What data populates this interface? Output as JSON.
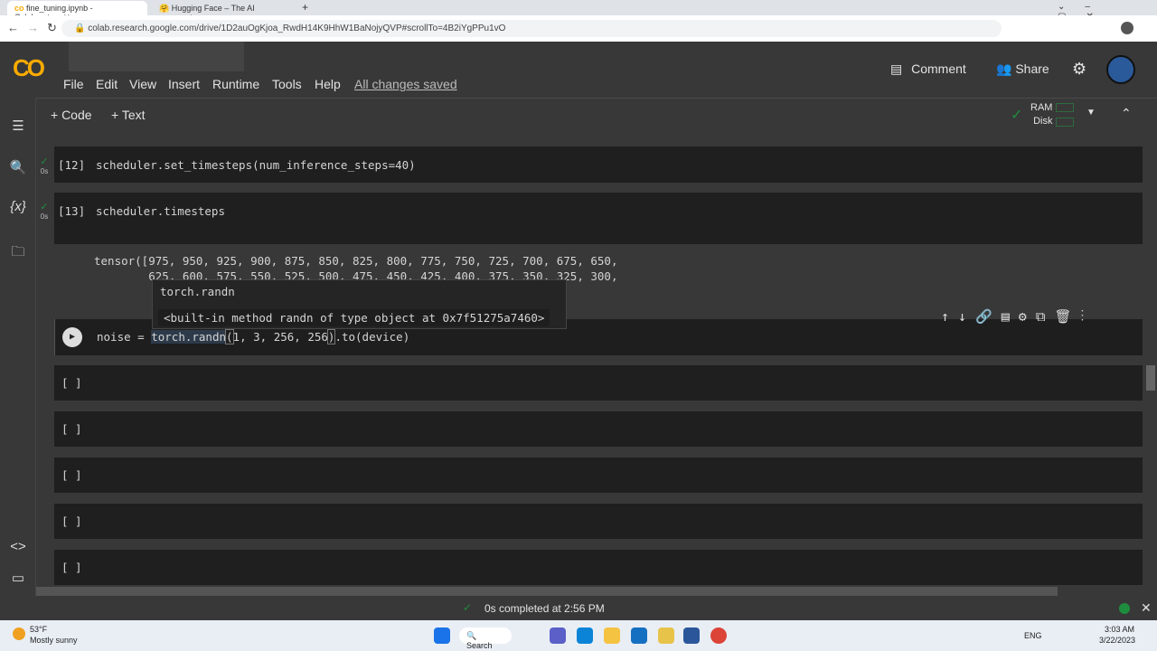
{
  "browser": {
    "tabs": [
      {
        "label": "fine_tuning.ipynb - Colaboratory",
        "active": true
      },
      {
        "label": "Hugging Face – The AI communi",
        "active": false
      }
    ],
    "url": "colab.research.google.com/drive/1D2auOgKjoa_RwdH14K9HhW1BaNojyQVP#scrollTo=4B2iYgPPu1vO"
  },
  "header": {
    "logo": "CO",
    "menu": [
      "File",
      "Edit",
      "View",
      "Insert",
      "Runtime",
      "Tools",
      "Help"
    ],
    "save_status": "All changes saved",
    "comment": "Comment",
    "share": "Share"
  },
  "toolbar": {
    "add_code": "+ Code",
    "add_text": "+ Text",
    "ram": "RAM",
    "disk": "Disk"
  },
  "cells": [
    {
      "prompt": "[12]",
      "time": "0s",
      "code": "scheduler.set_timesteps(num_inference_steps=40)"
    },
    {
      "prompt": "[13]",
      "time": "0s",
      "code": "scheduler.timesteps",
      "output": [
        "tensor([975, 950, 925, 900, 875, 850, 825, 800, 775, 750, 725, 700, 675, 650,",
        "        625, 600, 575, 550, 525, 500, 475, 450, 425, 400, 375, 350, 325, 300,"
      ]
    },
    {
      "prompt": "",
      "code_parts": [
        "noise = ",
        "torch.randn",
        "(",
        "1, 3, 256, 256",
        ")",
        ".to(device)"
      ]
    },
    {
      "prompt": "[ ]"
    },
    {
      "prompt": "[ ]"
    },
    {
      "prompt": "[ ]"
    },
    {
      "prompt": "[ ]"
    },
    {
      "prompt": "[ ]"
    }
  ],
  "tooltip": {
    "title": "torch.randn",
    "doc": "<built-in method randn of type object at 0x7f51275a7460>"
  },
  "status": {
    "text": "0s completed at 2:56 PM"
  },
  "taskbar": {
    "weather_temp": "53°F",
    "weather_desc": "Mostly sunny",
    "search": "Search",
    "lang": "ENG",
    "time": "3:03 AM",
    "date": "3/22/2023"
  },
  "colors": {
    "accent": "#f9ab00",
    "check": "#1e8e3e",
    "cell_bg": "#1f1f1f",
    "page_bg": "#383838"
  }
}
